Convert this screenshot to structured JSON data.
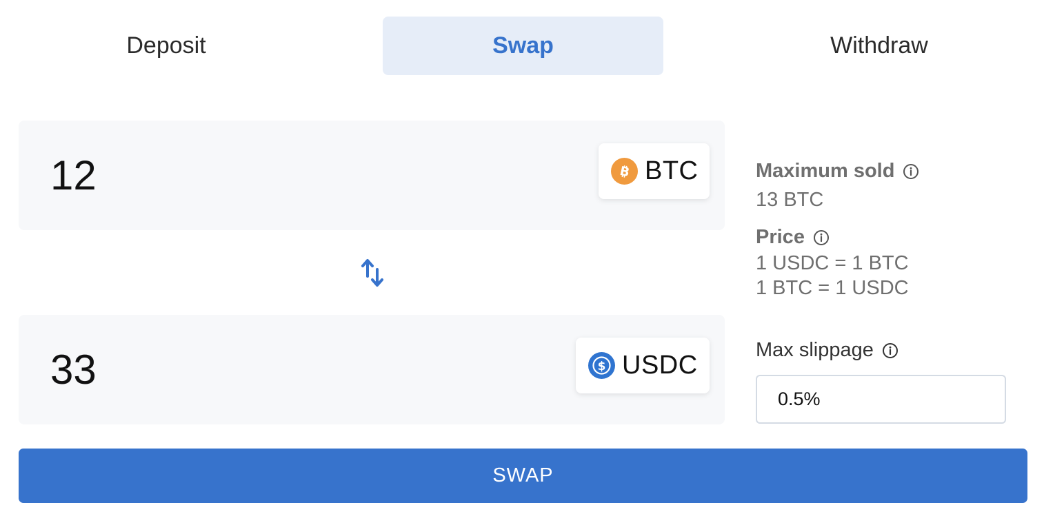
{
  "tabs": {
    "deposit_label": "Deposit",
    "swap_label": "Swap",
    "withdraw_label": "Withdraw",
    "active": "Swap"
  },
  "from": {
    "amount": "12",
    "token": "BTC",
    "token_icon": "bitcoin-icon",
    "token_color": "#f09a3e"
  },
  "to": {
    "amount": "33",
    "token": "USDC",
    "token_icon": "usdc-icon",
    "token_color": "#2f74d0"
  },
  "switch": {
    "icon": "swap-arrows-icon"
  },
  "info": {
    "max_sold_title": "Maximum sold",
    "max_sold_value": "13 BTC",
    "price_title": "Price",
    "price_line1": "1 USDC = 1 BTC",
    "price_line2": "1 BTC = 1 USDC",
    "slippage_label": "Max slippage",
    "slippage_value": "0.5%"
  },
  "actions": {
    "swap_button_label": "SWAP"
  },
  "colors": {
    "accent": "#3773cc",
    "active_tab_bg": "#e6edf8",
    "panel_bg": "#f7f8fa",
    "muted_text": "#6f6f6f"
  }
}
